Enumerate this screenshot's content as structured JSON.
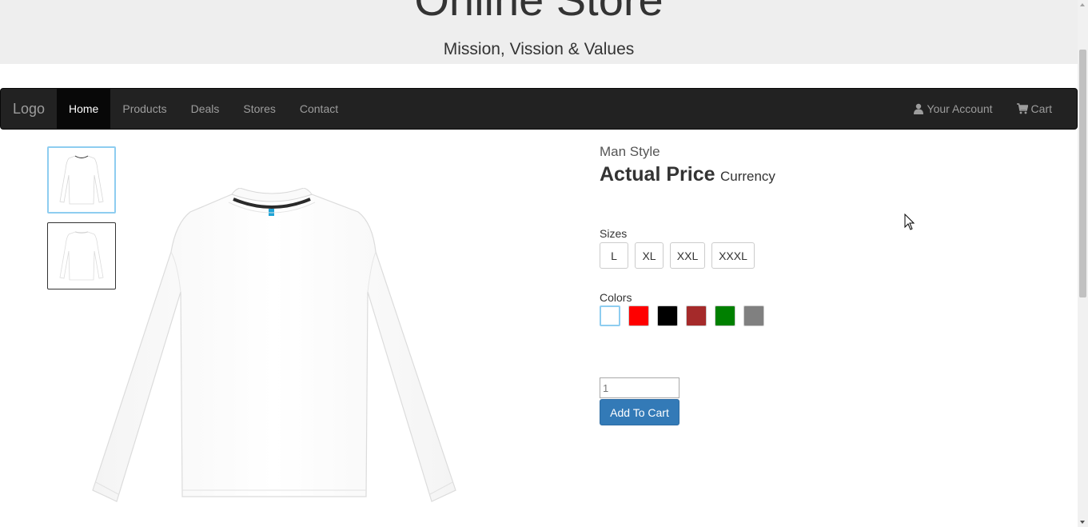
{
  "header": {
    "title": "Online Store",
    "subtitle": "Mission, Vission & Values"
  },
  "navbar": {
    "brand": "Logo",
    "items": [
      {
        "label": "Home",
        "active": true
      },
      {
        "label": "Products",
        "active": false
      },
      {
        "label": "Deals",
        "active": false
      },
      {
        "label": "Stores",
        "active": false
      },
      {
        "label": "Contact",
        "active": false
      }
    ],
    "account": {
      "label": "Your Account",
      "icon": "user-icon"
    },
    "cart": {
      "label": "Cart",
      "icon": "cart-icon"
    }
  },
  "product": {
    "brand": "Man Style",
    "price": "Actual Price",
    "currency": "Currency",
    "sizes_label": "Sizes",
    "sizes": [
      "L",
      "XL",
      "XXL",
      "XXXL"
    ],
    "colors_label": "Colors",
    "colors": [
      "#ffffff",
      "#ff0000",
      "#000000",
      "#a52a2a",
      "#008000",
      "#808080"
    ],
    "selected_color": "#ffffff",
    "quantity": "1",
    "add_to_cart": "Add To Cart"
  },
  "colors": {
    "navbar_bg": "#222222",
    "jumbotron_bg": "#eeeeee",
    "primary": "#337ab7",
    "selected_outline": "#8ecdf0"
  }
}
